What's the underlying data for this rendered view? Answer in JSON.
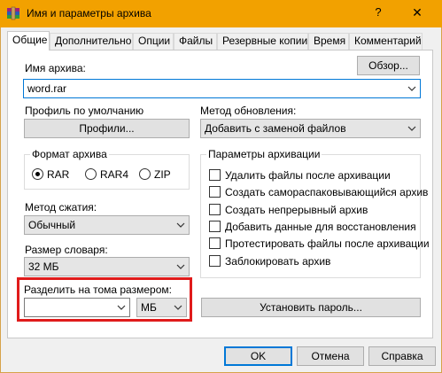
{
  "window": {
    "title": "Имя и параметры архива",
    "help": "?",
    "close": "✕"
  },
  "tabs": [
    {
      "label": "Общие"
    },
    {
      "label": "Дополнительно"
    },
    {
      "label": "Опции"
    },
    {
      "label": "Файлы"
    },
    {
      "label": "Резервные копии"
    },
    {
      "label": "Время"
    },
    {
      "label": "Комментарий"
    }
  ],
  "archive_name": {
    "label": "Имя архива:",
    "value": "word.rar",
    "browse": "Обзор..."
  },
  "profile": {
    "label": "Профиль по умолчанию",
    "button": "Профили..."
  },
  "update_method": {
    "label": "Метод обновления:",
    "value": "Добавить с заменой файлов"
  },
  "format": {
    "title": "Формат архива",
    "options": [
      "RAR",
      "RAR4",
      "ZIP"
    ],
    "selected": "RAR"
  },
  "compression": {
    "label": "Метод сжатия:",
    "value": "Обычный"
  },
  "dictionary": {
    "label": "Размер словаря:",
    "value": "32 МБ"
  },
  "split": {
    "label": "Разделить на тома размером:",
    "value": "",
    "unit": "МБ"
  },
  "archive_params": {
    "title": "Параметры архивации",
    "options": [
      "Удалить файлы после архивации",
      "Создать самораспаковывающийся архив",
      "Создать непрерывный архив",
      "Добавить данные для восстановления",
      "Протестировать файлы после архивации",
      "Заблокировать архив"
    ]
  },
  "set_password": "Установить пароль...",
  "footer": {
    "ok": "OK",
    "cancel": "Отмена",
    "help": "Справка"
  },
  "colors": {
    "title_bar": "#f2a100",
    "highlight": "#e01b1b",
    "accent": "#0078d7"
  }
}
